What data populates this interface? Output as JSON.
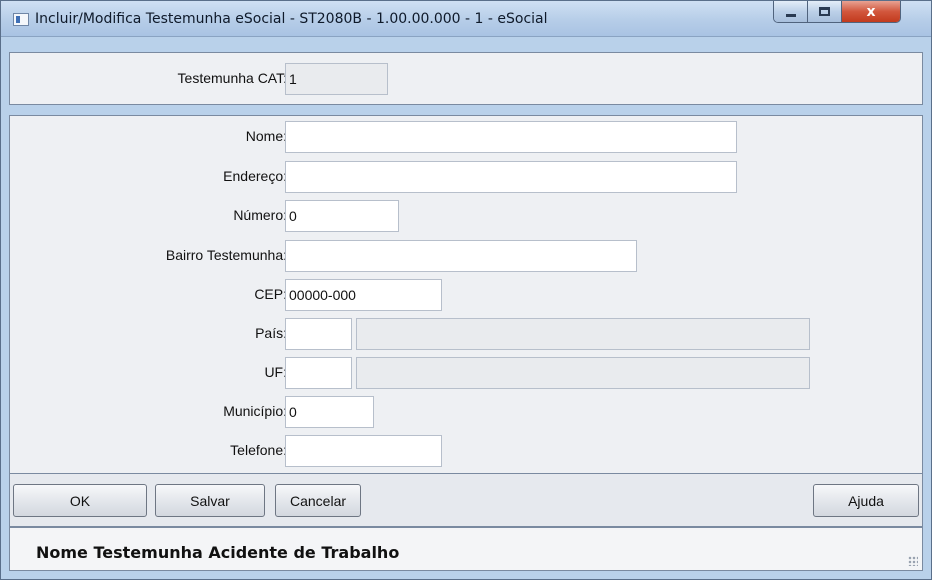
{
  "window": {
    "title": "Incluir/Modifica Testemunha eSocial - ST2080B - 1.00.00.000 - 1 - eSocial",
    "close_glyph": "x"
  },
  "header": {
    "testemunha_cat_label": "Testemunha CAT:",
    "testemunha_cat_value": "1"
  },
  "form": {
    "nome_label": "Nome:",
    "nome_value": "",
    "endereco_label": "Endereço:",
    "endereco_value": "",
    "numero_label": "Número:",
    "numero_value": "0",
    "bairro_label": "Bairro Testemunha:",
    "bairro_value": "",
    "cep_label": "CEP:",
    "cep_value": "00000-000",
    "pais_label": "País:",
    "pais_code": "",
    "pais_desc": "",
    "uf_label": "UF:",
    "uf_code": "",
    "uf_desc": "",
    "municipio_label": "Município:",
    "municipio_value": "0",
    "telefone_label": "Telefone:",
    "telefone_value": ""
  },
  "buttons": {
    "ok": "OK",
    "salvar": "Salvar",
    "cancelar": "Cancelar",
    "ajuda": "Ajuda"
  },
  "status": {
    "text": "Nome Testemunha Acidente de Trabalho"
  },
  "icons": [
    "app-window-icon",
    "minimize-icon",
    "maximize-icon",
    "close-icon",
    "resize-grip-icon"
  ]
}
